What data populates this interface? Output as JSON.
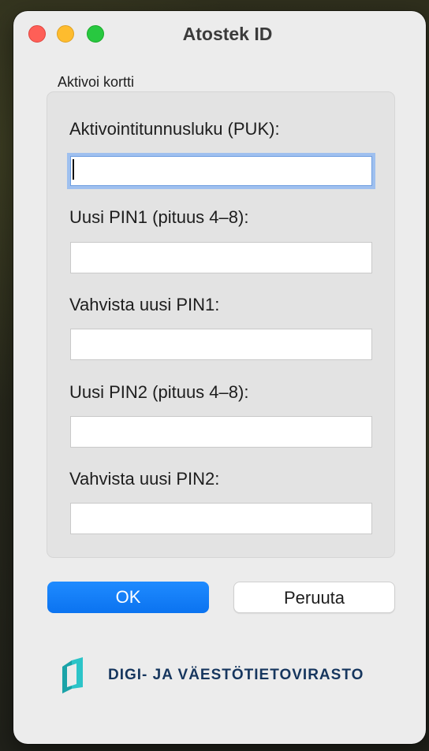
{
  "window": {
    "title": "Atostek ID"
  },
  "group": {
    "label": "Aktivoi kortti"
  },
  "fields": [
    {
      "label": "Aktivointitunnusluku (PUK):",
      "value": "",
      "placeholder": ""
    },
    {
      "label": "Uusi PIN1 (pituus 4–8):",
      "value": "",
      "placeholder": ""
    },
    {
      "label": "Vahvista uusi PIN1:",
      "value": "",
      "placeholder": ""
    },
    {
      "label": "Uusi PIN2 (pituus 4–8):",
      "value": "",
      "placeholder": ""
    },
    {
      "label": "Vahvista uusi PIN2:",
      "value": "",
      "placeholder": ""
    }
  ],
  "buttons": {
    "ok_label": "OK",
    "cancel_label": "Peruuta"
  },
  "branding": {
    "logo_icon": "dvv-logo-icon",
    "agency_name": "DIGI- JA VÄESTÖTIETOVIRASTO"
  },
  "colors": {
    "ok_button": "#0b73f0",
    "focus_ring": "#9fc0ef",
    "brand_text": "#16365e",
    "logo_teal": "#1aa3a8"
  }
}
